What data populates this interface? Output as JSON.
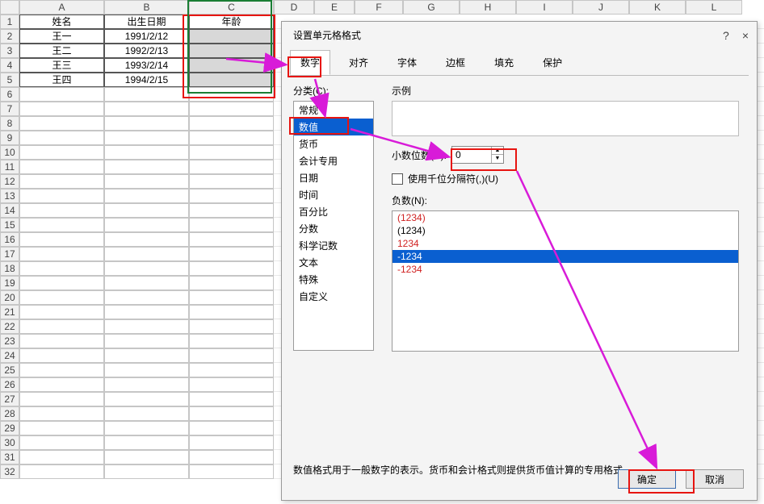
{
  "sheet": {
    "columns": [
      "A",
      "B",
      "C",
      "D",
      "E",
      "F",
      "G",
      "H",
      "I",
      "J",
      "K",
      "L"
    ],
    "rows": [
      "1",
      "2",
      "3",
      "4",
      "5",
      "6",
      "7",
      "8",
      "9",
      "10",
      "11",
      "12",
      "13",
      "14",
      "15",
      "16",
      "17",
      "18",
      "19",
      "20",
      "21",
      "22",
      "23",
      "24",
      "25",
      "26",
      "27",
      "28",
      "29",
      "30",
      "31",
      "32"
    ],
    "header": {
      "A": "姓名",
      "B": "出生日期",
      "C": "年龄"
    },
    "data": [
      {
        "A": "王一",
        "B": "1991/2/12",
        "C": ""
      },
      {
        "A": "王二",
        "B": "1992/2/13",
        "C": ""
      },
      {
        "A": "王三",
        "B": "1993/2/14",
        "C": ""
      },
      {
        "A": "王四",
        "B": "1994/2/15",
        "C": ""
      }
    ]
  },
  "dialog": {
    "title": "设置单元格格式",
    "help": "?",
    "close": "×",
    "tabs": {
      "number": "数字",
      "align": "对齐",
      "font": "字体",
      "border": "边框",
      "fill": "填充",
      "protect": "保护"
    },
    "category_label": "分类(C):",
    "categories": [
      "常规",
      "数值",
      "货币",
      "会计专用",
      "日期",
      "时间",
      "百分比",
      "分数",
      "科学记数",
      "文本",
      "特殊",
      "自定义"
    ],
    "sample_label": "示例",
    "decimal_label": "小数位数(D):",
    "decimal_value": "0",
    "thousand_label": "使用千位分隔符(,)(U)",
    "negative_label": "负数(N):",
    "negatives": [
      {
        "text": "(1234)",
        "red": true
      },
      {
        "text": "(1234)",
        "red": false
      },
      {
        "text": "1234",
        "red": true
      },
      {
        "text": "-1234",
        "sel": true
      },
      {
        "text": "-1234",
        "red": true
      }
    ],
    "description": "数值格式用于一般数字的表示。货币和会计格式则提供货币值计算的专用格式。",
    "ok": "确定",
    "cancel": "取消"
  }
}
